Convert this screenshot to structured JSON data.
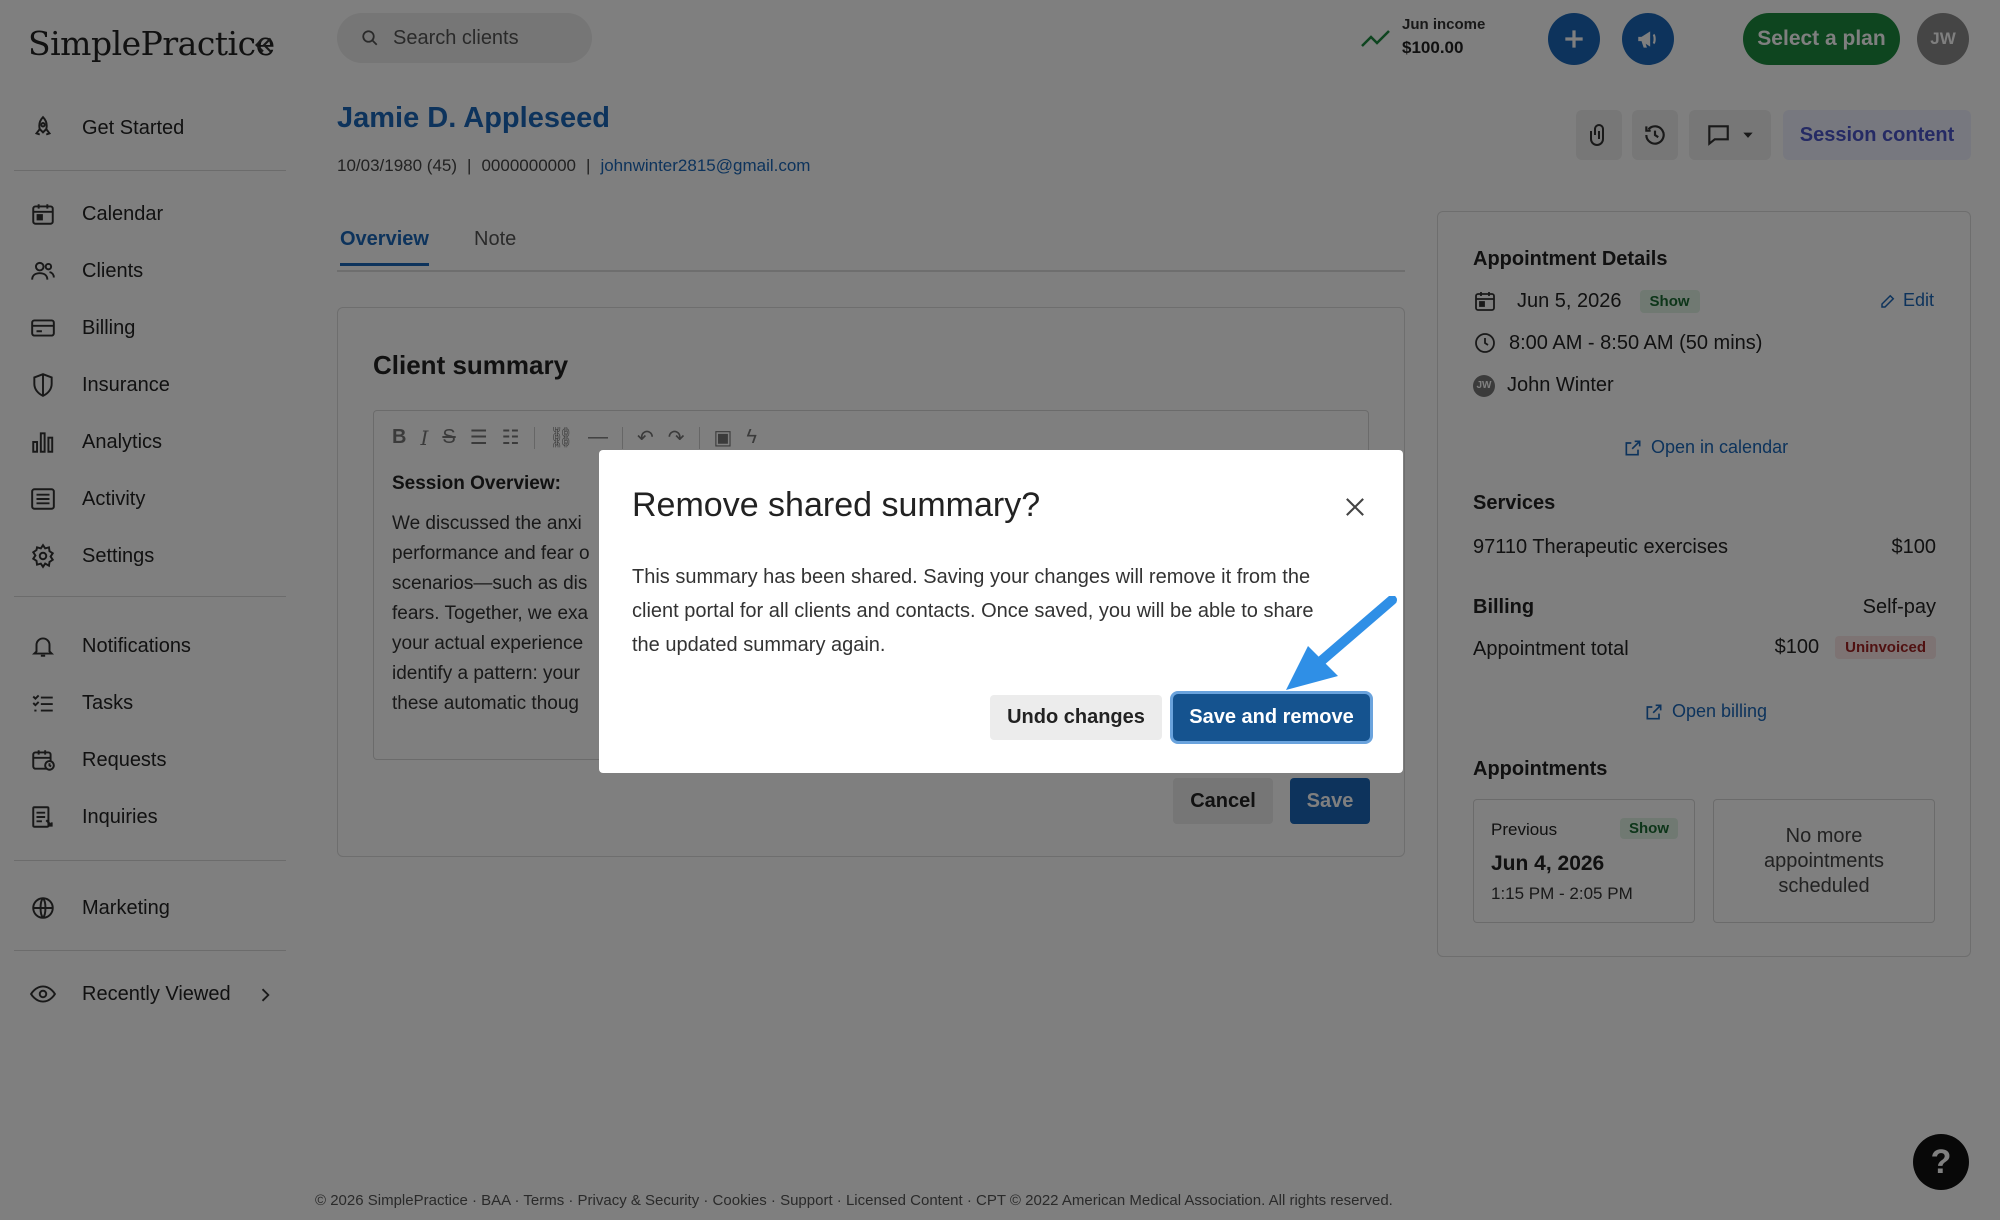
{
  "app": {
    "logo": "SimplePractice"
  },
  "sidebar": {
    "items": [
      {
        "label": "Get Started",
        "icon": "rocket-icon"
      },
      {
        "label": "Calendar",
        "icon": "calendar-icon"
      },
      {
        "label": "Clients",
        "icon": "clients-icon"
      },
      {
        "label": "Billing",
        "icon": "billing-icon"
      },
      {
        "label": "Insurance",
        "icon": "shield-icon"
      },
      {
        "label": "Analytics",
        "icon": "bar-chart-icon"
      },
      {
        "label": "Activity",
        "icon": "activity-list-icon"
      },
      {
        "label": "Settings",
        "icon": "gear-icon"
      },
      {
        "label": "Notifications",
        "icon": "bell-icon"
      },
      {
        "label": "Tasks",
        "icon": "tasks-icon"
      },
      {
        "label": "Requests",
        "icon": "requests-icon"
      },
      {
        "label": "Inquiries",
        "icon": "inquiries-icon"
      },
      {
        "label": "Marketing",
        "icon": "globe-icon"
      },
      {
        "label": "Recently Viewed",
        "icon": "eye-icon"
      }
    ]
  },
  "topbar": {
    "search_placeholder": "Search clients",
    "income_label": "Jun income",
    "income_value": "$100.00",
    "plan_button": "Select a plan",
    "avatar_initials": "JW"
  },
  "client": {
    "name": "Jamie D. Appleseed",
    "dob": "10/03/1980 (45)",
    "phone": "0000000000",
    "email": "johnwinter2815@gmail.com",
    "separator": "|",
    "session_content_label": "Session content"
  },
  "tabs": [
    {
      "label": "Overview",
      "active": true
    },
    {
      "label": "Note",
      "active": false
    }
  ],
  "summary": {
    "title": "Client summary",
    "heading": "Session Overview:",
    "lines": [
      "We discussed the anxi",
      "performance and fear o",
      "scenarios—such as dis",
      "fears. Together, we exa",
      "your actual experience",
      "identify a pattern: your",
      "these automatic thoug"
    ],
    "cancel_label": "Cancel",
    "save_label": "Save"
  },
  "appointment": {
    "details_title": "Appointment Details",
    "date": "Jun 5, 2026",
    "status": "Show",
    "edit_label": "Edit",
    "time": "8:00 AM - 8:50 AM (50 mins)",
    "clinician_initials": "JW",
    "clinician": "John Winter",
    "open_calendar_label": "Open in calendar",
    "services_title": "Services",
    "service_name": "97110 Therapeutic exercises",
    "service_price": "$100",
    "billing_title": "Billing",
    "billing_type": "Self-pay",
    "total_label": "Appointment total",
    "total_value": "$100",
    "invoice_status": "Uninvoiced",
    "open_billing_label": "Open billing",
    "appointments_title": "Appointments",
    "previous": {
      "label": "Previous",
      "status": "Show",
      "date": "Jun 4, 2026",
      "time": "1:15 PM - 2:05 PM"
    },
    "no_more": [
      "No more",
      "appointments",
      "scheduled"
    ]
  },
  "modal": {
    "title": "Remove shared summary?",
    "body_lines": [
      "This summary has been shared. Saving your changes will remove it from the",
      "client portal for all clients and contacts. Once saved, you will be able to share",
      "the updated summary again."
    ],
    "undo_label": "Undo changes",
    "confirm_label": "Save and remove"
  },
  "footer": {
    "text": "© 2026 SimplePractice · BAA · Terms · Privacy & Security · Cookies · Support · Licensed Content · CPT © 2022 American Medical Association. All rights reserved."
  },
  "help": {
    "label": "?"
  },
  "colors": {
    "accent": "#1a67b8",
    "plan_green": "#1c8b3f",
    "overlay": "rgba(0,0,0,0.5)",
    "highlight_arrow": "#2f8fe6"
  }
}
